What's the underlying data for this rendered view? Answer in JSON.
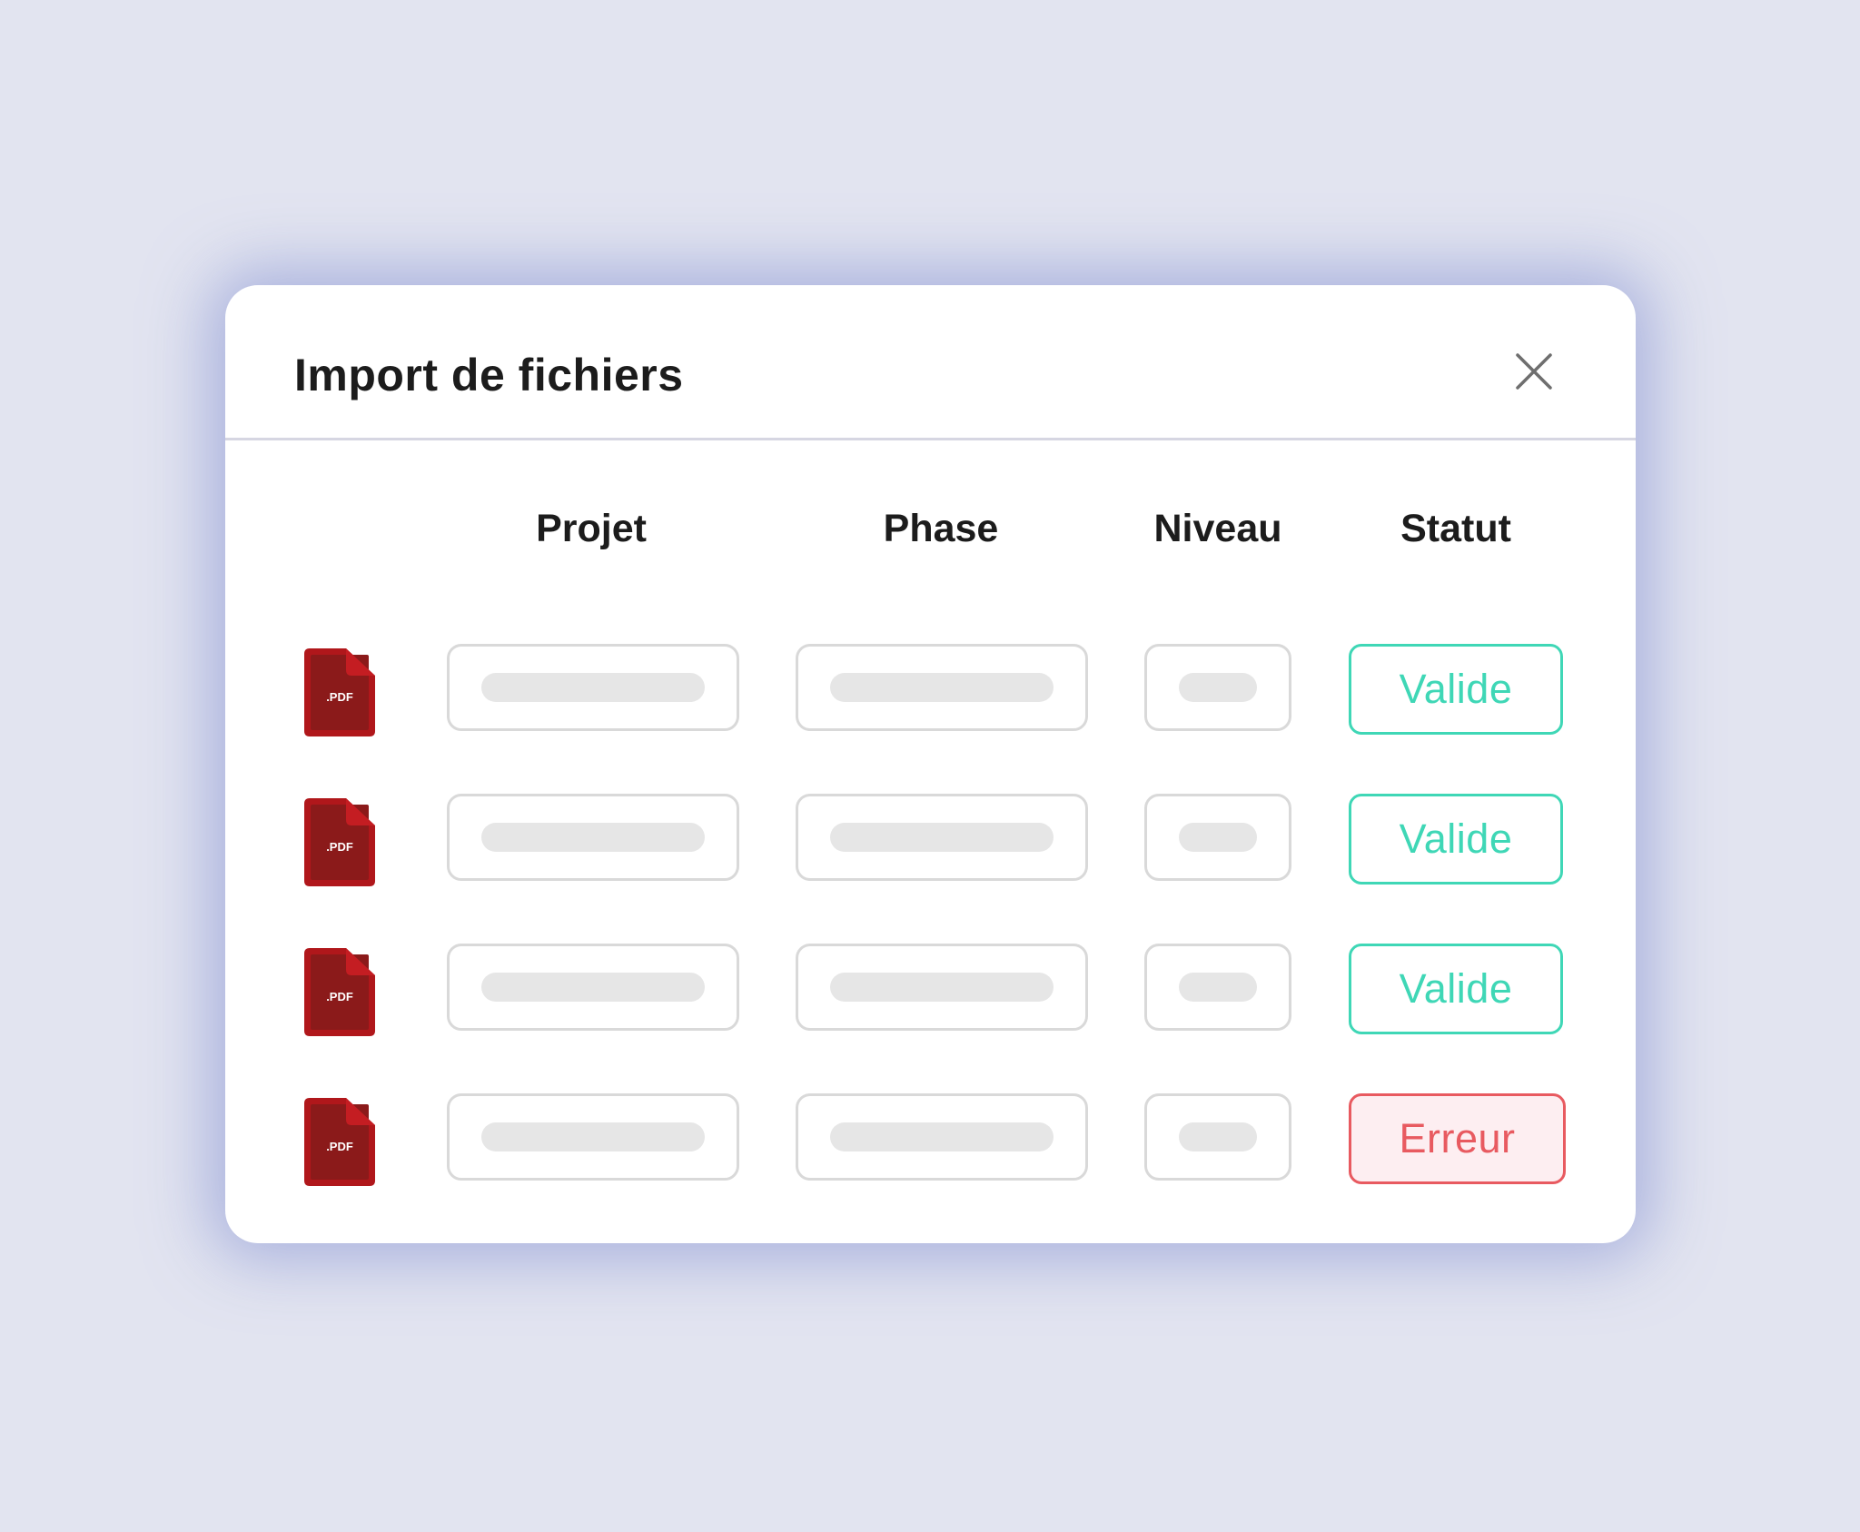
{
  "dialog": {
    "title": "Import de fichiers",
    "close_icon": "close-icon"
  },
  "table": {
    "columns": [
      "Projet",
      "Phase",
      "Niveau",
      "Statut"
    ],
    "file_icon": "pdf-file-icon",
    "file_label": ".PDF",
    "rows": [
      {
        "type": ".PDF",
        "status": "Valide",
        "status_kind": "valid"
      },
      {
        "type": ".PDF",
        "status": "Valide",
        "status_kind": "valid"
      },
      {
        "type": ".PDF",
        "status": "Valide",
        "status_kind": "valid"
      },
      {
        "type": ".PDF",
        "status": "Erreur",
        "status_kind": "error"
      }
    ]
  },
  "colors": {
    "background": "#e2e4f0",
    "pdf_red": "#b0171b",
    "pdf_dark_red": "#8b1a1a",
    "valid": "#3fd7b6",
    "error": "#e85a60",
    "error_fill": "#fdeef1"
  }
}
